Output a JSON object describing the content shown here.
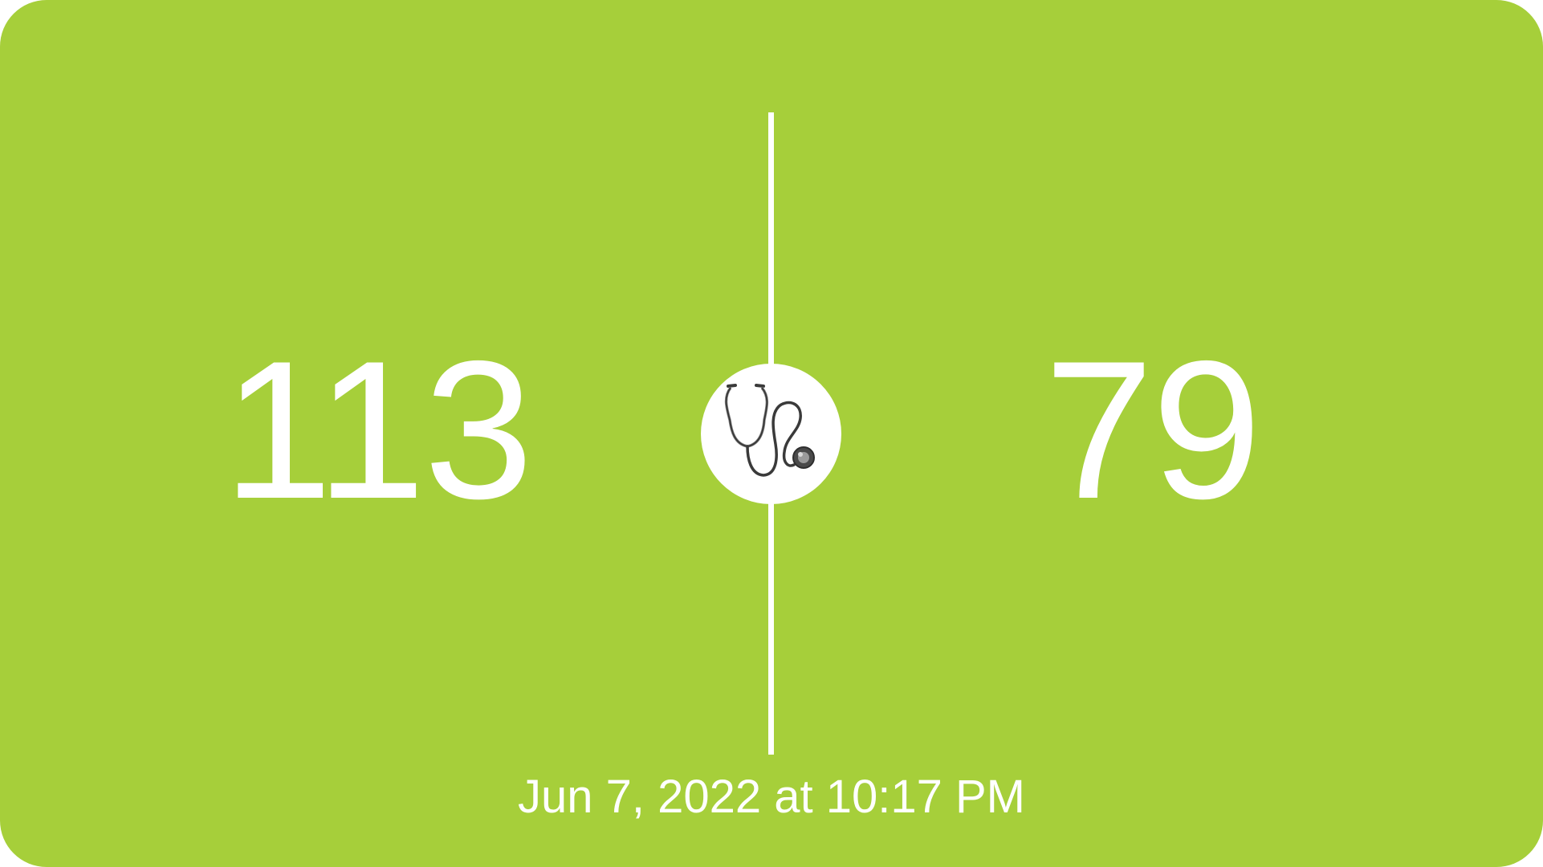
{
  "reading": {
    "systolic": "113",
    "diastolic": "79",
    "timestamp": "Jun 7, 2022 at 10:17 PM"
  },
  "badge": {
    "icon": "stethoscope-icon"
  },
  "colors": {
    "background": "#A6CF3A",
    "foreground": "#FFFFFF",
    "icon_stroke": "#3A3A3A"
  }
}
